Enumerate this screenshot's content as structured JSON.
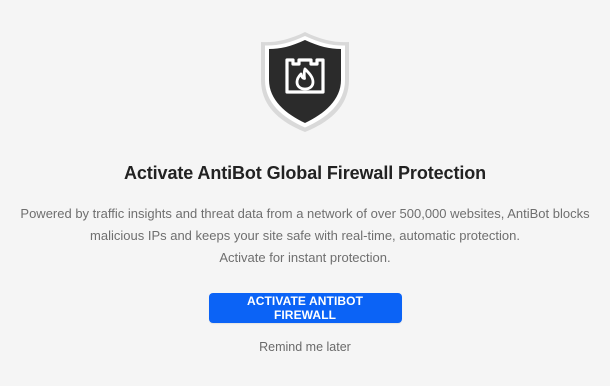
{
  "hero": {
    "icon": "shield-fire-icon",
    "title": "Activate AntiBot Global Firewall Protection",
    "description": {
      "line1": "Powered by traffic insights and threat data from a network of over 500,000 websites, AntiBot blocks",
      "line2": "malicious IPs and keeps your site safe with real-time, automatic protection.",
      "line3": "Activate for instant protection."
    }
  },
  "actions": {
    "activate_label": "ACTIVATE ANTIBOT FIREWALL",
    "remind_label": "Remind me later"
  },
  "colors": {
    "primary": "#0b63f6",
    "shield_dark": "#2b2b2b",
    "shield_border": "#d6d6d6",
    "background": "#f5f5f5"
  }
}
